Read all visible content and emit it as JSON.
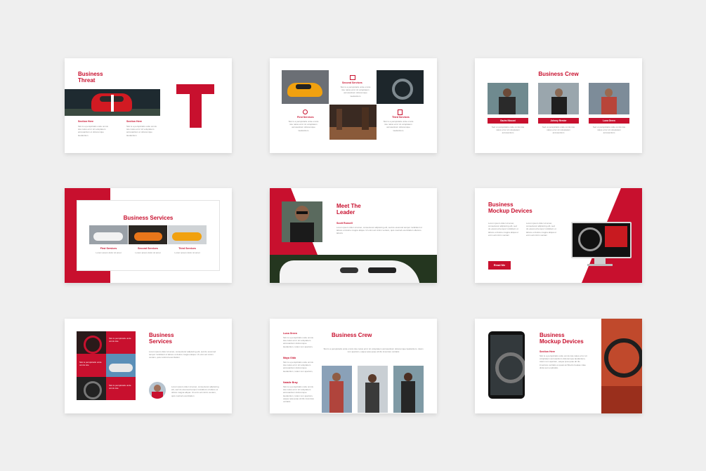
{
  "brand_color": "#c8102e",
  "slides": {
    "s1": {
      "title": "Business\nThreat",
      "letter": "T",
      "col1_title": "Section Here",
      "col2_title": "Section Here",
      "body": "Slot is a perspiciatis unde omnis iste natus error sit voluptatem accusantium et doloremque laudantium"
    },
    "s2": {
      "items": [
        "Second Services",
        "First Services",
        "Third Services"
      ],
      "body": "Slot is a perspiciatis unde omnis iste natus error sit voluptatem accusantium doloremque laudantium"
    },
    "s3": {
      "title": "Business Crew",
      "names": [
        "Gazim Nicsoni",
        "Johnny Remier",
        "Luna Green"
      ],
      "body": "Sed ut perspiciatis unde omnis iste natus error sit voluptatem accusantium"
    },
    "s4": {
      "title": "Business Services",
      "labels": [
        "First Services",
        "Second Services",
        "Third Services"
      ],
      "body": "Lorem ipsum dolor sit amet"
    },
    "s5": {
      "title": "Meet The\nLeader",
      "name": "Scott Russell",
      "body": "Lorem ipsum dolor sit amet, consectetur adipiscing elit, sed do eiusmod tempor incididunt ut labore et dolore magna aliqua. Ut enim ad minim veniam, quis nostrud exercitation ullamco laboris"
    },
    "s6": {
      "title": "Business\nMockup Devices",
      "button": "Read Me",
      "body": "Lorem ipsum dolor sit amet, consectetur adipiscing elit, sed do eiusmod tempor incididunt ut labore et dolore magna aliqua ut enim ad minim veniam"
    },
    "s7": {
      "title": "Business\nServices",
      "body": "Lorem ipsum dolor sit amet, consectetur adipiscing elit, sed do eiusmod tempor incididunt ut labore et dolore magna aliqua. Ut enim ad minim veniam, quis nostrud exercitation",
      "tile": "Slot is perspiciatis unde omnis iste"
    },
    "s8": {
      "title": "Business Crew",
      "names": [
        "Luna Green",
        "Maya Gibb",
        "Natalie Bray"
      ],
      "body": "Slot is a perspiciatis unde omnis iste natus error sit voluptatem accusantium doloremque laudantium, totam rem aperiam, eaque ipsa quae ab illo inventore veritatis"
    },
    "s9": {
      "title": "Business\nMockup Devices",
      "sub": "Section Here",
      "body": "Slot is a perspiciatis unde omnis iste natus error sit voluptatem accusantium doloremque laudantium, totam rem aperiam, eaque ipsa quae ab illo inventore veritatis et quasi architecto beatae vitae dicta sunt explicabo"
    }
  }
}
